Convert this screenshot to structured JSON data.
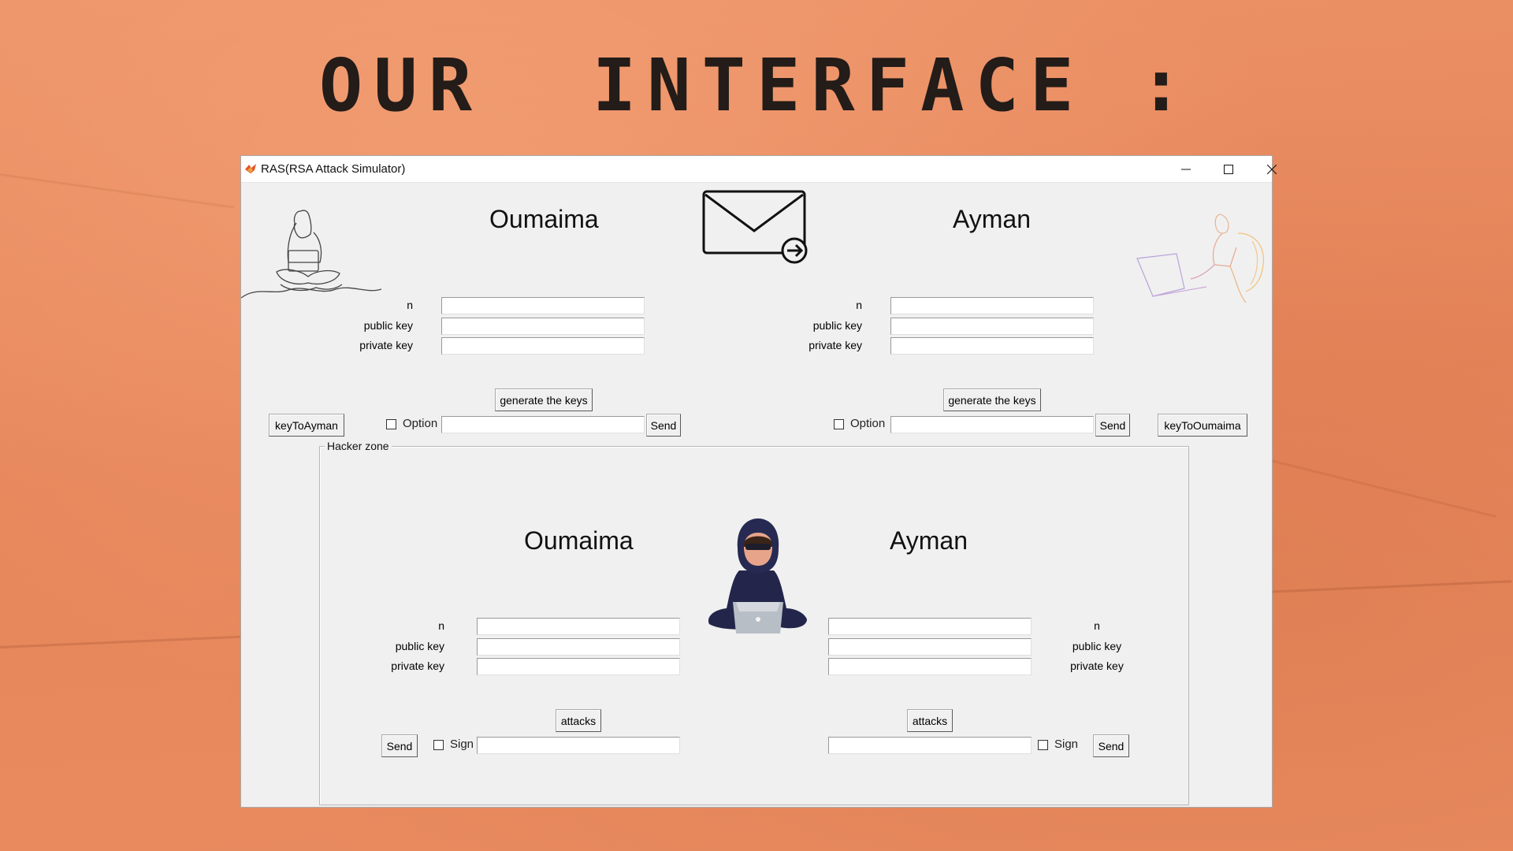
{
  "slide": {
    "title": "OUR  INTERFACE :"
  },
  "window": {
    "title": "RAS(RSA Attack Simulator)",
    "controls": [
      "minimize-icon",
      "maximize-icon",
      "close-icon"
    ]
  },
  "top": {
    "left": {
      "name": "Oumaima",
      "n_label": "n",
      "public_label": "public key",
      "private_label": "private key",
      "generate_label": "generate the keys",
      "key_button": "keyToAyman",
      "option_label": "Option",
      "send_label": "Send",
      "n_value": "",
      "public_value": "",
      "private_value": "",
      "message_value": ""
    },
    "right": {
      "name": "Ayman",
      "n_label": "n",
      "public_label": "public key",
      "private_label": "private key",
      "generate_label": "generate the keys",
      "key_button": "keyToOumaima",
      "option_label": "Option",
      "send_label": "Send",
      "n_value": "",
      "public_value": "",
      "private_value": "",
      "message_value": ""
    }
  },
  "hacker": {
    "frame_label": "Hacker zone",
    "left": {
      "name": "Oumaima",
      "n_label": "n",
      "public_label": "public key",
      "private_label": "private key",
      "attacks_label": "attacks",
      "send_label": "Send",
      "sign_label": "Sign",
      "n_value": "",
      "public_value": "",
      "private_value": "",
      "message_value": ""
    },
    "right": {
      "name": "Ayman",
      "n_label": "n",
      "public_label": "public key",
      "private_label": "private key",
      "attacks_label": "attacks",
      "send_label": "Send",
      "sign_label": "Sign",
      "n_value": "",
      "public_value": "",
      "private_value": "",
      "message_value": ""
    }
  },
  "icons": {
    "envelope": "envelope-send-icon",
    "woman": "woman-laptop-sketch",
    "man": "man-laptop-sketch",
    "hacker": "hacker-laptop-icon"
  }
}
